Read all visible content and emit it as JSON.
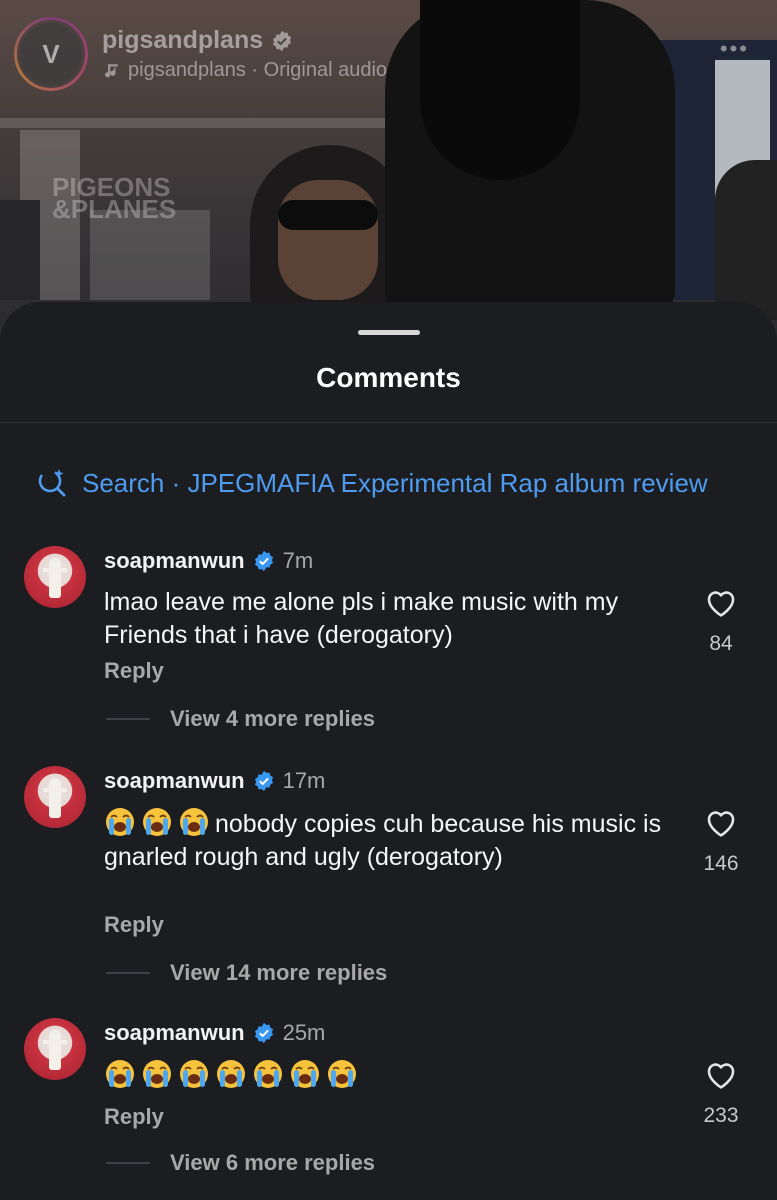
{
  "reel": {
    "account_name": "pigsandplans",
    "audio_label": "pigsandplans · Original audio",
    "avatar_initial": "V",
    "watermark_line1": "PIGEONS",
    "watermark_line2": "&PLANES",
    "more_icon": "more-horizontal-icon"
  },
  "sheet": {
    "title": "Comments",
    "search_text": "Search · JPEGMAFIA Experimental Rap album review",
    "search_icon": "ai-search-icon"
  },
  "comments": [
    {
      "username": "soapmanwun",
      "time": "7m",
      "text": "lmao leave me alone pls i make music with my Friends that i have (derogatory)",
      "emoji_count": 0,
      "likes": "84",
      "reply_label": "Reply",
      "view_replies": "View 4 more replies"
    },
    {
      "username": "soapmanwun",
      "time": "17m",
      "text": "nobody copies cuh because his music is gnarled rough and ugly (derogatory)",
      "emoji_count": 3,
      "emoji_name": "loudly-crying-face-emoji",
      "likes": "146",
      "reply_label": "Reply",
      "view_replies": "View 14 more replies"
    },
    {
      "username": "soapmanwun",
      "time": "25m",
      "text": "",
      "emoji_count": 7,
      "emoji_name": "loudly-crying-face-emoji",
      "likes": "233",
      "reply_label": "Reply",
      "view_replies": "View 6 more replies"
    }
  ],
  "colors": {
    "background": "#1b1d20",
    "accent_blue": "#4e9bf0",
    "verified_blue": "#3897f0",
    "muted_text": "#a8a8a8"
  }
}
